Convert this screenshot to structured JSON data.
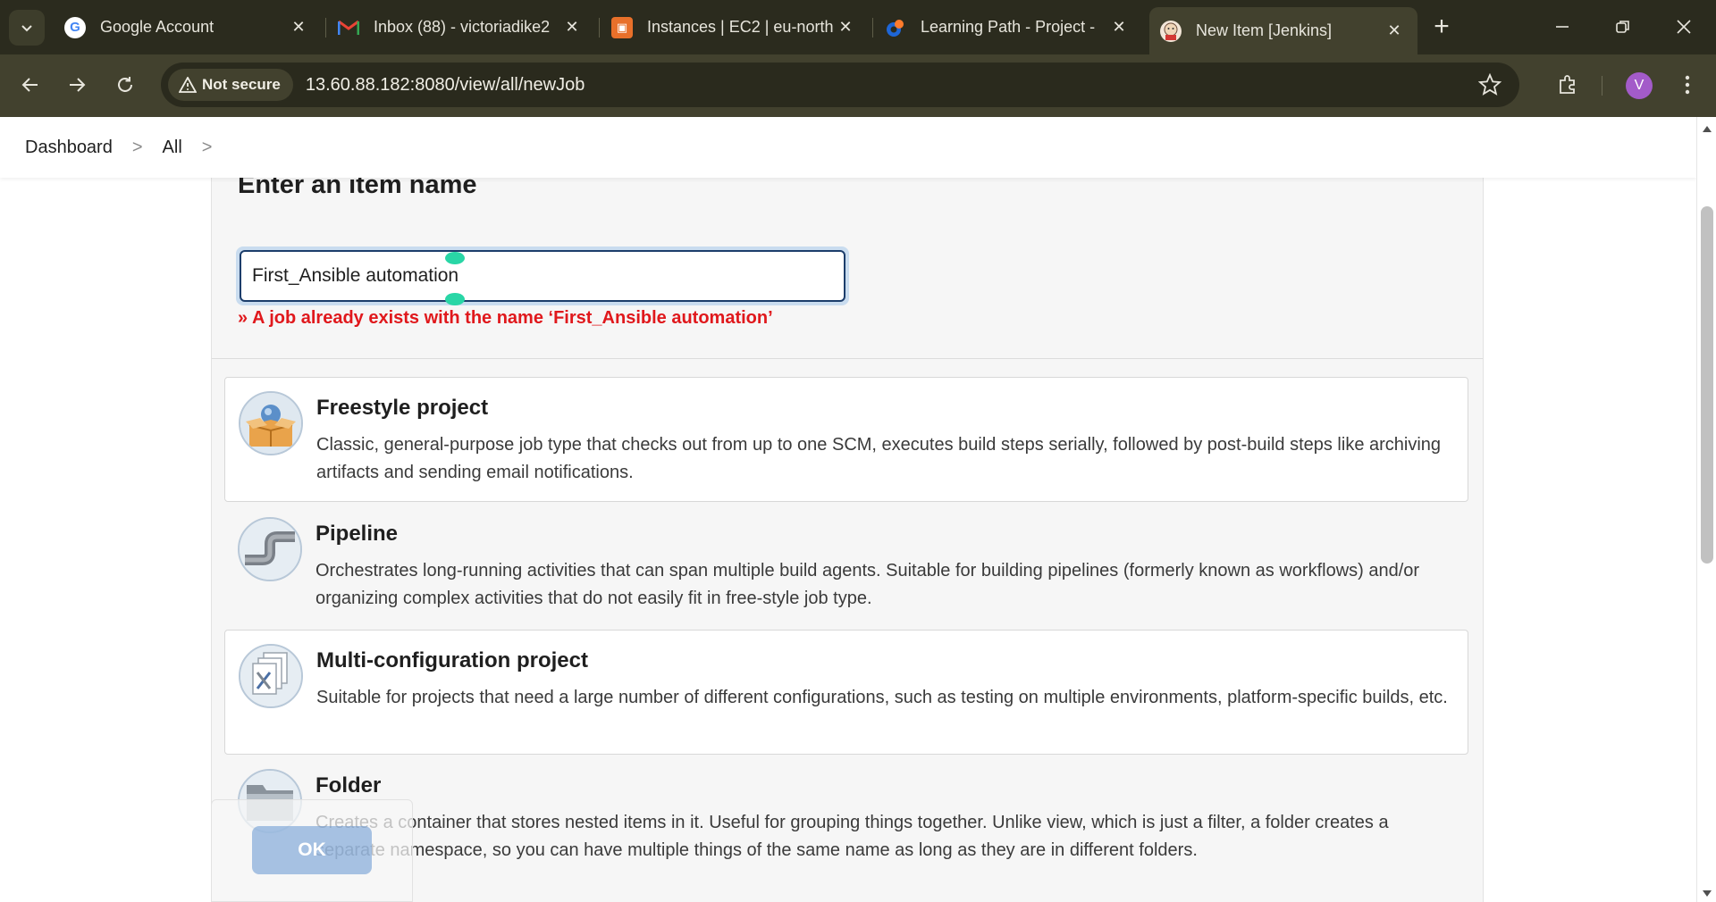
{
  "browser": {
    "tabs": [
      {
        "title": "Google Account",
        "icon": "google-icon",
        "color": "#4285f4"
      },
      {
        "title": "Inbox (88) - victoriadike2",
        "icon": "gmail-icon",
        "color": "#ea4335"
      },
      {
        "title": "Instances | EC2 | eu-north",
        "icon": "aws-ec2-icon",
        "color": "#e8702a"
      },
      {
        "title": "Learning Path - Project -",
        "icon": "learning-path-icon",
        "color": "#1e66d6"
      },
      {
        "title": "New Item [Jenkins]",
        "icon": "jenkins-icon",
        "color": "#d33833"
      }
    ],
    "active_tab_index": 4,
    "security_label": "Not secure",
    "url": "13.60.88.182:8080/view/all/newJob",
    "profile_initial": "V",
    "profile_color": "#a35bc9"
  },
  "breadcrumb": {
    "items": [
      "Dashboard",
      "All"
    ]
  },
  "form": {
    "title": "Enter an item name",
    "item_name_value": "First_Ansible automation",
    "error": "» A job already exists with the name ‘First_Ansible automation’"
  },
  "item_types": [
    {
      "name": "Freestyle project",
      "description": "Classic, general-purpose job type that checks out from up to one SCM, executes build steps serially, followed by post-build steps like archiving artifacts and sending email notifications.",
      "icon": "freestyle-box-icon"
    },
    {
      "name": "Pipeline",
      "description": "Orchestrates long-running activities that can span multiple build agents. Suitable for building pipelines (formerly known as workflows) and/or organizing complex activities that do not easily fit in free-style job type.",
      "icon": "pipeline-pipe-icon"
    },
    {
      "name": "Multi-configuration project",
      "description": "Suitable for projects that need a large number of different configurations, such as testing on multiple environments, platform-specific builds, etc.",
      "icon": "multi-config-icon"
    },
    {
      "name": "Folder",
      "description": "Creates a container that stores nested items in it. Useful for grouping things together. Unlike view, which is just a filter, a folder creates a separate namespace, so you can have multiple things of the same name as long as they are in different folders.",
      "icon": "folder-icon"
    }
  ],
  "actions": {
    "ok_label": "OK"
  },
  "colors": {
    "error": "#e0181c",
    "input_focus_border": "#1c3d6b",
    "ok_button": "#6496d2"
  }
}
